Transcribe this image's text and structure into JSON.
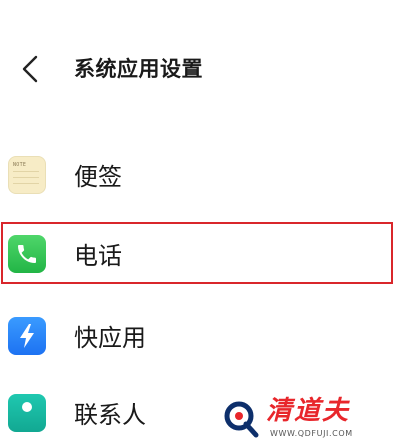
{
  "header": {
    "back_icon": "chevron-left-icon",
    "title": "系统应用设置"
  },
  "apps": [
    {
      "label": "便签",
      "icon": "notes-icon",
      "icon_text": "NOTE",
      "icon_color": "#f7ecc6"
    },
    {
      "label": "电话",
      "icon": "phone-icon",
      "icon_color": "#2fc452",
      "highlighted": true,
      "highlight_color": "#d9262b"
    },
    {
      "label": "快应用",
      "icon": "quick-app-icon",
      "icon_color": "#2a86f8"
    },
    {
      "label": "联系人",
      "icon": "contacts-icon",
      "icon_color": "#17b8a0"
    }
  ],
  "watermark": {
    "brand": "清道夫",
    "url": "WWW.QDFUJI.COM",
    "brand_color": "#e8262b"
  }
}
